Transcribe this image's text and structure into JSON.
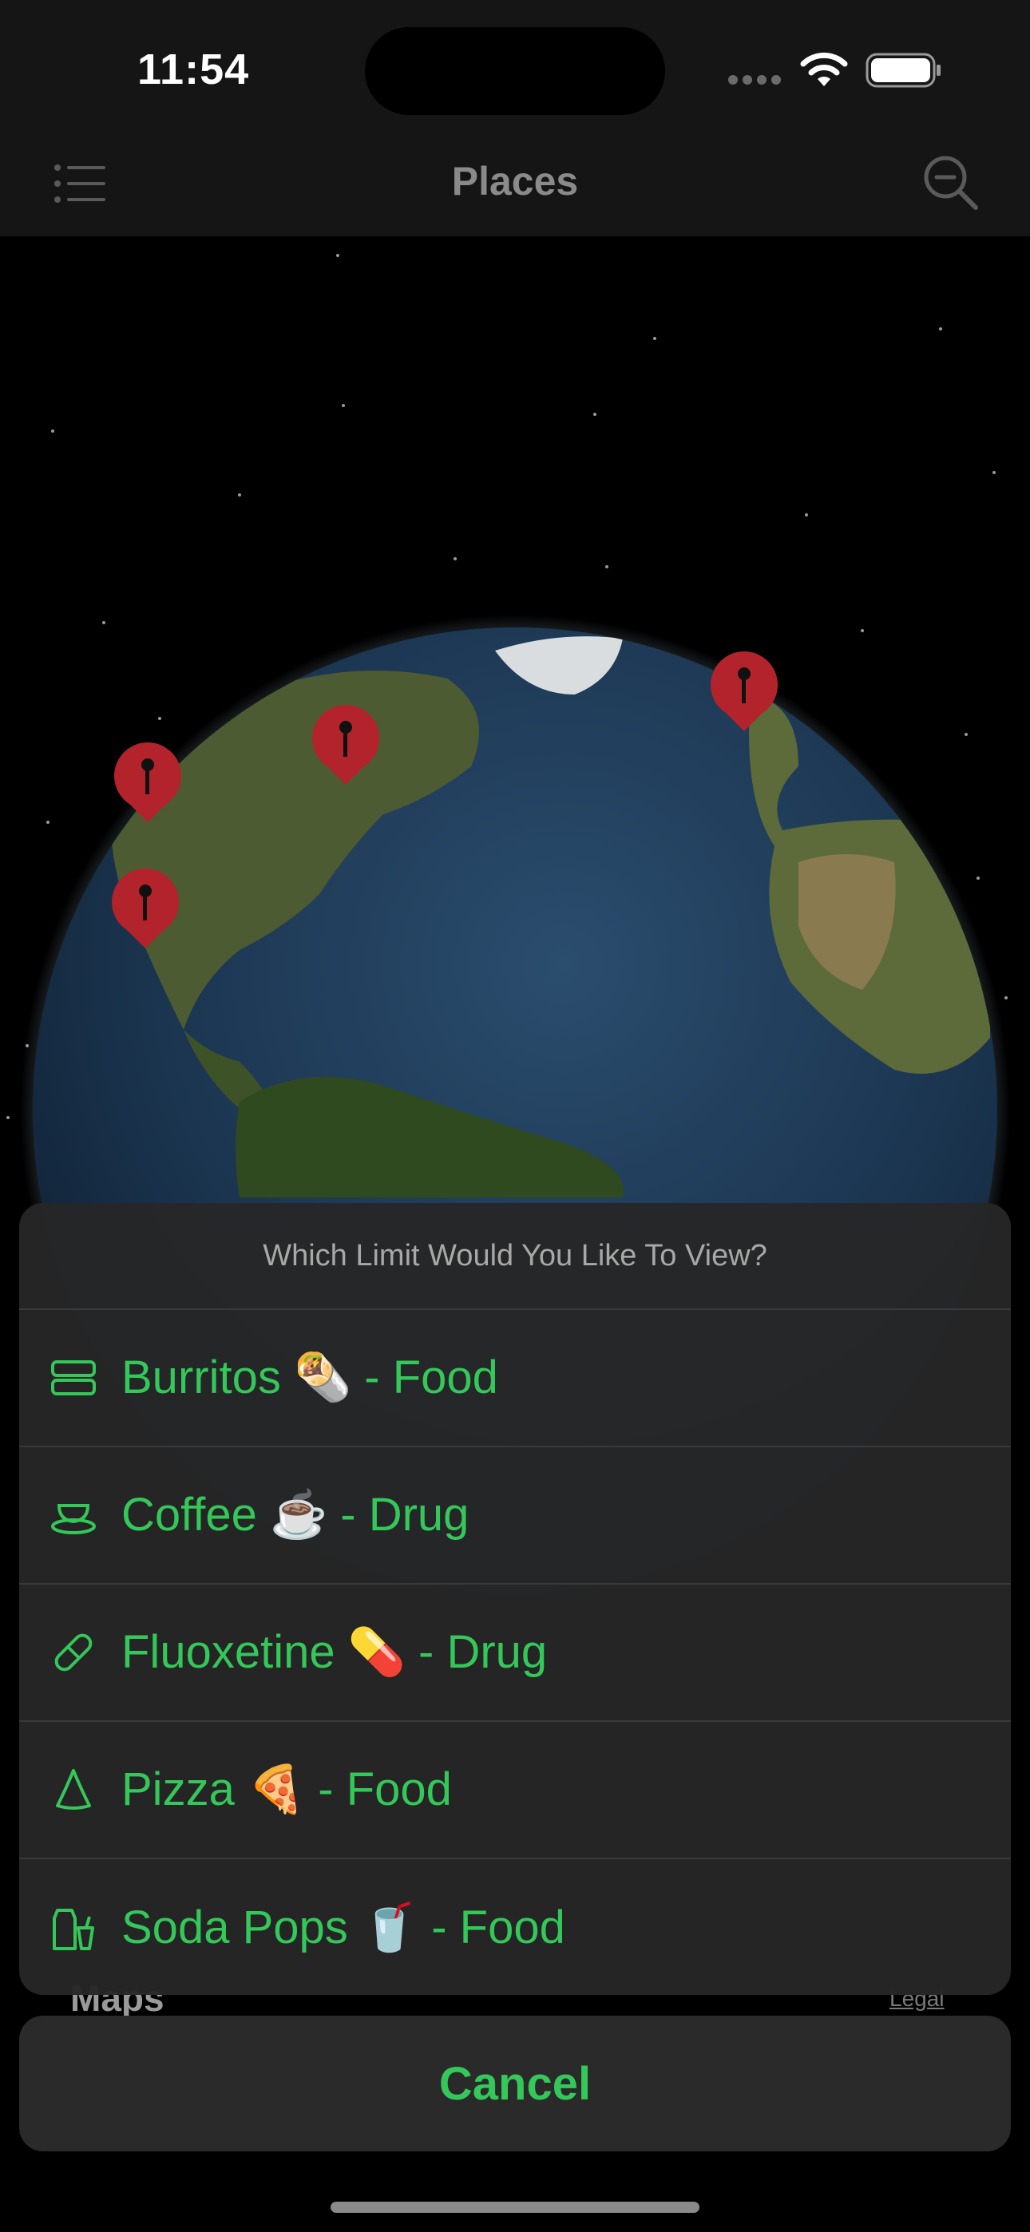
{
  "status_bar": {
    "time": "11:54"
  },
  "nav": {
    "title": "Places",
    "left_icon": "list-icon",
    "right_icon": "search-icon"
  },
  "map": {
    "attribution": "Maps",
    "legal": "Legal",
    "pin_color": "#b3232b"
  },
  "action_sheet": {
    "title": "Which Limit Would You Like To View?",
    "items": [
      {
        "label": "Burritos 🌯  - Food",
        "icon": "burrito-icon"
      },
      {
        "label": "Coffee ☕️  - Drug",
        "icon": "cup-icon"
      },
      {
        "label": "Fluoxetine 💊  - Drug",
        "icon": "pill-icon"
      },
      {
        "label": "Pizza 🍕  - Food",
        "icon": "pizza-slice-icon"
      },
      {
        "label": "Soda Pops 🥤  - Food",
        "icon": "drink-icon"
      }
    ],
    "cancel_label": "Cancel",
    "accent_color": "#34c759"
  }
}
